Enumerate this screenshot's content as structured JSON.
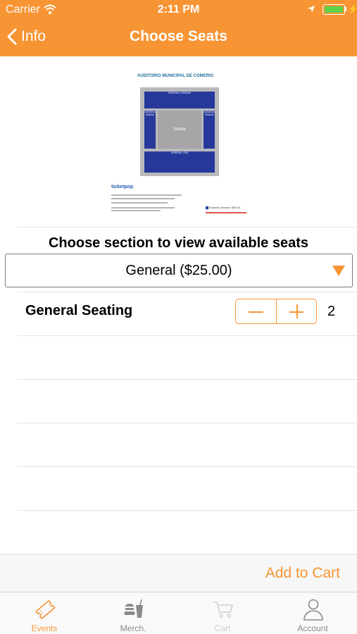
{
  "status_bar": {
    "carrier": "Carrier",
    "time": "2:11 PM"
  },
  "nav": {
    "back_label": "Info",
    "title": "Choose Seats"
  },
  "seat_map": {
    "title": "AUDITORIO MUNICIPAL DE COMERIO",
    "sections": {
      "top": "GENERAL GRADAS",
      "left": "GENERAL GRADA",
      "right": "GENERAL GRADA",
      "bottom": "GENERAL SUR"
    },
    "stage": "TARIMA",
    "logo": "ticketpop",
    "legend_label": "Entrada General",
    "legend_price": "$25.00"
  },
  "section_picker": {
    "heading": "Choose section to view available seats",
    "selected": "General ($25.00)"
  },
  "seating": {
    "label": "General Seating",
    "quantity": "2"
  },
  "cart": {
    "add_label": "Add to Cart"
  },
  "tabs": [
    {
      "label": "Events",
      "icon": "ticket-icon"
    },
    {
      "label": "Merch.",
      "icon": "merch-icon"
    },
    {
      "label": "Cart",
      "icon": "cart-icon"
    },
    {
      "label": "Account",
      "icon": "account-icon"
    }
  ],
  "colors": {
    "accent": "#f79534",
    "section_blue": "#26399b",
    "stage_gray": "#a6a6a8"
  }
}
